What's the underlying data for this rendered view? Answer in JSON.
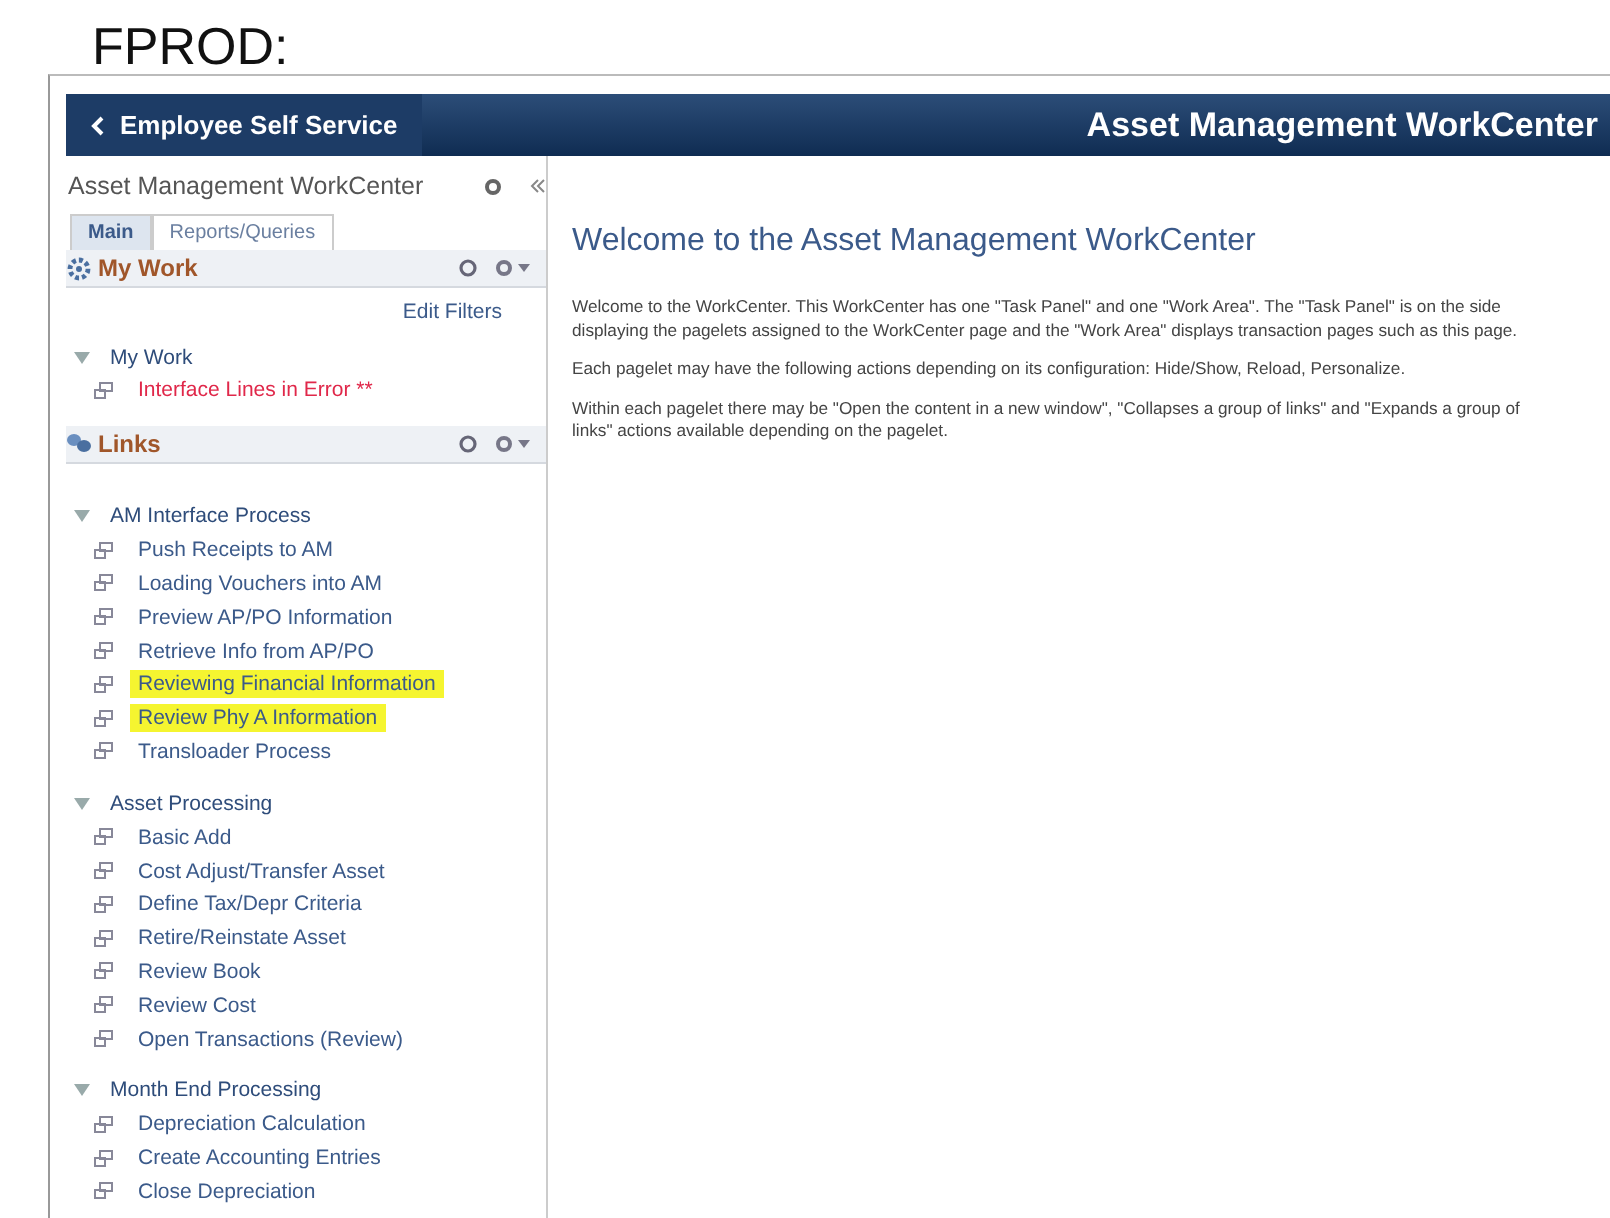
{
  "caption": "FPROD:",
  "header": {
    "back_label": "Employee Self Service",
    "title": "Asset Management WorkCenter"
  },
  "sidebar": {
    "title": "Asset Management WorkCenter",
    "tabs": [
      {
        "label": "Main",
        "selected": true
      },
      {
        "label": "Reports/Queries",
        "selected": false
      }
    ],
    "my_work": {
      "title": "My Work",
      "edit_filters": "Edit Filters",
      "group": {
        "label": "My Work",
        "expanded": true,
        "items": [
          {
            "label": "Interface Lines in Error **",
            "kind": "error",
            "highlighted": false
          }
        ]
      }
    },
    "links": {
      "title": "Links",
      "groups": [
        {
          "label": "AM Interface Process",
          "expanded": true,
          "items": [
            {
              "label": "Push Receipts to AM",
              "kind": "link",
              "highlighted": false
            },
            {
              "label": "Loading Vouchers into AM",
              "kind": "link",
              "highlighted": false
            },
            {
              "label": "Preview AP/PO Information",
              "kind": "link",
              "highlighted": false
            },
            {
              "label": "Retrieve Info from AP/PO",
              "kind": "link",
              "highlighted": false
            },
            {
              "label": "Reviewing Financial Information",
              "kind": "link",
              "highlighted": true
            },
            {
              "label": "Review Phy A Information",
              "kind": "link",
              "highlighted": true
            },
            {
              "label": "Transloader Process",
              "kind": "link",
              "highlighted": false
            }
          ]
        },
        {
          "label": "Asset Processing",
          "expanded": true,
          "items": [
            {
              "label": "Basic Add",
              "kind": "link",
              "highlighted": false
            },
            {
              "label": "Cost Adjust/Transfer Asset",
              "kind": "link",
              "highlighted": false
            },
            {
              "label": "Define Tax/Depr Criteria",
              "kind": "link",
              "highlighted": false
            },
            {
              "label": "Retire/Reinstate Asset",
              "kind": "link",
              "highlighted": false
            },
            {
              "label": "Review Book",
              "kind": "link",
              "highlighted": false
            },
            {
              "label": "Review Cost",
              "kind": "link",
              "highlighted": false
            },
            {
              "label": "Open Transactions (Review)",
              "kind": "link",
              "highlighted": false
            }
          ]
        },
        {
          "label": "Month End Processing",
          "expanded": true,
          "items": [
            {
              "label": "Depreciation Calculation",
              "kind": "link",
              "highlighted": false
            },
            {
              "label": "Create Accounting Entries",
              "kind": "link",
              "highlighted": false
            },
            {
              "label": "Close Depreciation",
              "kind": "link",
              "highlighted": false
            }
          ]
        }
      ]
    }
  },
  "content": {
    "heading": "Welcome to the Asset Management WorkCenter",
    "paragraphs": [
      "Welcome to the WorkCenter. This WorkCenter has one \"Task Panel\" and one \"Work Area\". The \"Task Panel\" is on the side displaying the pagelets assigned to the WorkCenter page and the \"Work Area\" displays transaction pages such as this page.",
      "Each pagelet may have the following actions depending on its configuration: Hide/Show, Reload, Personalize.",
      "Within each pagelet there may be \"Open the content in a new window\", \"Collapses a group of links\" and \"Expands a group of links\" actions available depending on the pagelet."
    ]
  }
}
